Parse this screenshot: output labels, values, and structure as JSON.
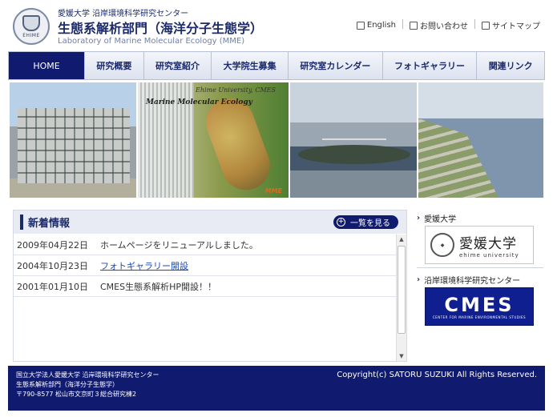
{
  "header": {
    "org_line": "愛媛大学 沿岸環境科学研究センター",
    "dept_title": "生態系解析部門（海洋分子生態学）",
    "lab_name": "Laboratory of Marine Molecular Ecology (MME)",
    "logo_text": "EHIME",
    "util_links": [
      {
        "label": "English",
        "icon": "page-icon"
      },
      {
        "label": "お問い合わせ",
        "icon": "mail-icon"
      },
      {
        "label": "サイトマップ",
        "icon": "sitemap-icon"
      }
    ]
  },
  "nav": {
    "items": [
      {
        "label": "HOME",
        "active": true
      },
      {
        "label": "研究概要"
      },
      {
        "label": "研究室紹介"
      },
      {
        "label": "大学院生募集"
      },
      {
        "label": "研究室カレンダー"
      },
      {
        "label": "フォトギャラリー"
      },
      {
        "label": "関連リンク"
      }
    ]
  },
  "banner": {
    "caption_univ": "Ehime University, CMES",
    "caption_title": "Marine Molecular Ecology",
    "caption_mark": "MME"
  },
  "news": {
    "title": "新着情報",
    "more_label": "一覧を見る",
    "items": [
      {
        "date": "2009年04月22日",
        "text": "ホームページをリニューアルしました。",
        "link": false
      },
      {
        "date": "2004年10月23日",
        "text": "フォトギャラリー開設",
        "link": true
      },
      {
        "date": "2001年01月10日",
        "text": "CMES生態系解析HP開設！！",
        "link": false
      }
    ]
  },
  "side": {
    "ehime_label": "愛媛大学",
    "ehime_logo_jp": "愛媛大学",
    "ehime_logo_en": "ehime university",
    "cmes_label": "沿岸環境科学研究センター",
    "cmes_logo": "CMES",
    "cmes_sub": "CENTER FOR MARINE ENVIRONMENTAL STUDIES"
  },
  "footer": {
    "line1": "国立大学法人愛媛大学 沿岸環境科学研究センター",
    "line2": "生態系解析部門（海洋分子生態学）",
    "line3": "〒790-8577 松山市文京町３総合研究棟2",
    "copyright": "Copyright(c) SATORU SUZUKI All Rights Reserved."
  }
}
